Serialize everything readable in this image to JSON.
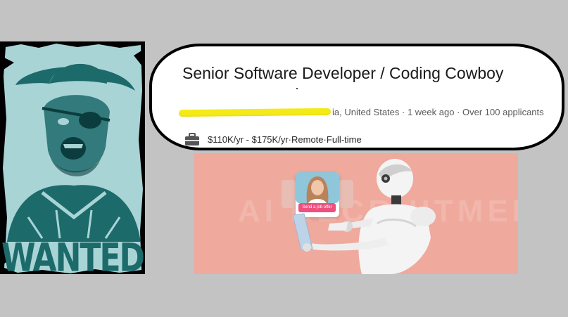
{
  "job": {
    "title": "Senior Software Developer / Coding Cowboy",
    "location_visible": "ia, United States",
    "posted": "1 week ago",
    "applicants": "Over 100 applicants",
    "separator": " · ",
    "salary": "$110K/yr - $175K/yr",
    "workplace": "Remote",
    "type": "Full-time"
  },
  "poster": {
    "text": "WANTED"
  },
  "ai_image": {
    "background_text": "AI RECRUITMENT",
    "offer_button_label": "Send a job offer"
  },
  "colors": {
    "page_background": "#c3c3c3",
    "poster_teal": "#1d6a6b",
    "poster_paper": "#a9d4d6",
    "highlight": "#f3ea18",
    "ai_background": "#efa99d",
    "offer_button": "#ee4f7e"
  },
  "icons": {
    "job_details": "briefcase-icon",
    "poster_figure": "cowboy-icon",
    "ai_figure": "robot-icon"
  }
}
